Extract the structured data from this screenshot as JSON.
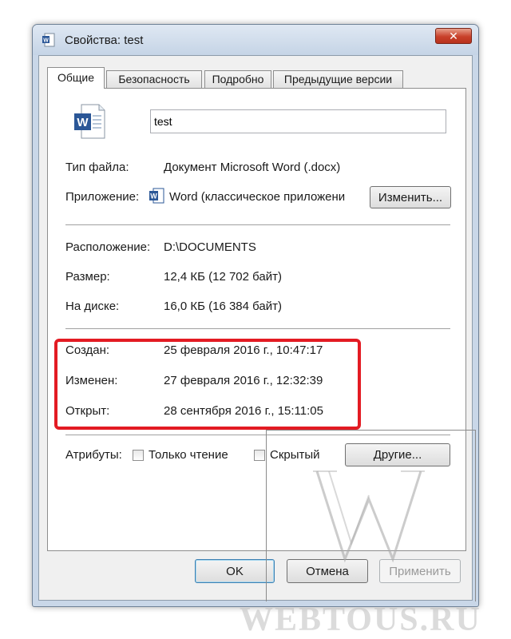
{
  "window": {
    "title": "Свойства: test",
    "close_label": "✕"
  },
  "tabs": [
    {
      "label": "Общие",
      "active": true
    },
    {
      "label": "Безопасность",
      "active": false
    },
    {
      "label": "Подробно",
      "active": false
    },
    {
      "label": "Предыдущие версии",
      "active": false
    }
  ],
  "general": {
    "file_name": "test",
    "type_label": "Тип файла:",
    "type_value": "Документ Microsoft Word (.docx)",
    "app_label": "Приложение:",
    "app_value": "Word (классическое приложени",
    "change_button": "Изменить...",
    "location_label": "Расположение:",
    "location_value": "D:\\DOCUMENTS",
    "size_label": "Размер:",
    "size_value": "12,4 КБ (12 702 байт)",
    "disk_label": "На диске:",
    "disk_value": "16,0 КБ (16 384 байт)",
    "created_label": "Создан:",
    "created_value": "25 февраля 2016 г., 10:47:17",
    "modified_label": "Изменен:",
    "modified_value": "27 февраля 2016 г., 12:32:39",
    "opened_label": "Открыт:",
    "opened_value": "28 сентября 2016 г., 15:11:05",
    "attributes_label": "Атрибуты:",
    "readonly_label": "Только чтение",
    "hidden_label": "Скрытый",
    "other_button": "Другие..."
  },
  "footer": {
    "ok": "OK",
    "cancel": "Отмена",
    "apply": "Применить"
  },
  "watermark": {
    "text": "WEBTOUS.RU"
  },
  "colors": {
    "highlight": "#e31b23",
    "word_blue": "#2b5797"
  }
}
